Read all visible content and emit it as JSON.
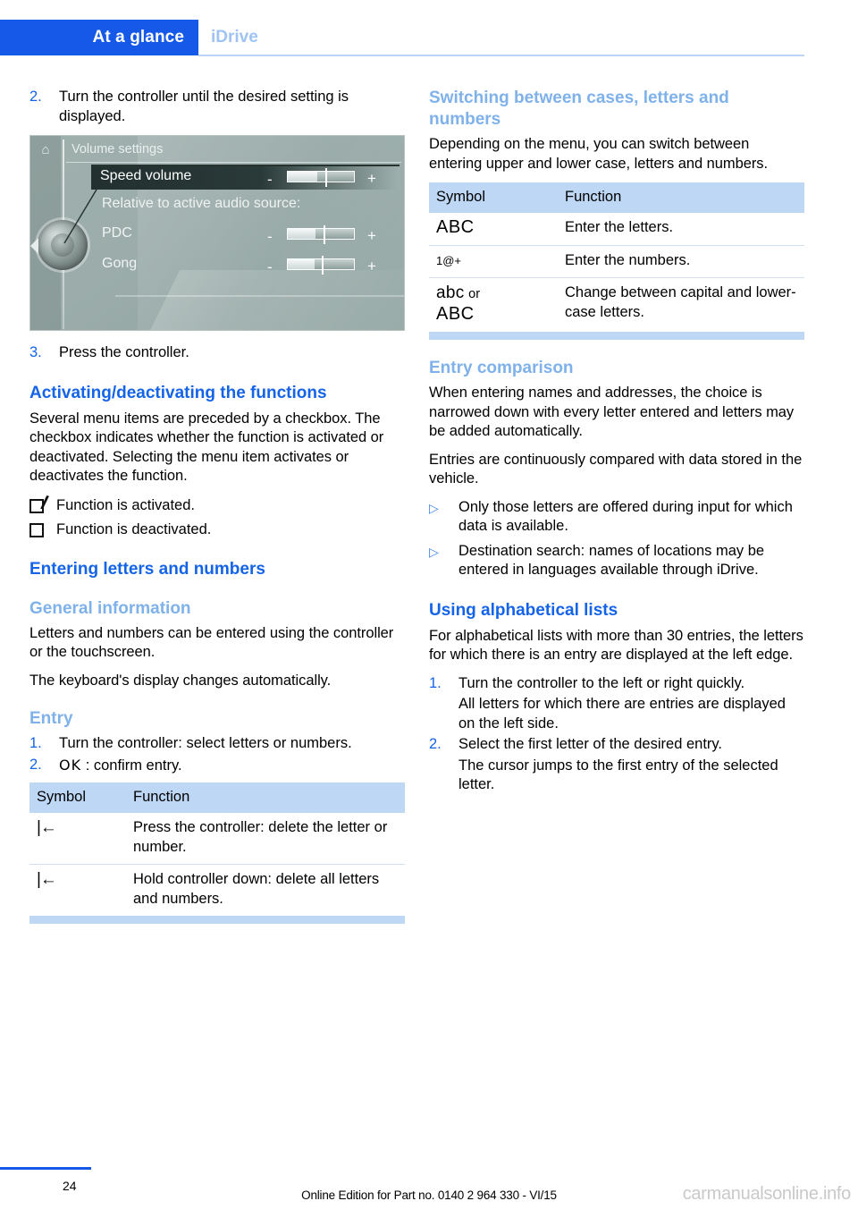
{
  "header": {
    "active_tab": "At a glance",
    "inactive_tab": "iDrive"
  },
  "colors": {
    "brand_blue": "#1659e8",
    "heading_blue": "#1564e8",
    "subheading_blue": "#7fb1ea",
    "table_header_blue": "#bdd7f4",
    "table_rule_blue": "#cfe0f5"
  },
  "left_column": {
    "step2": {
      "num": "2.",
      "text": "Turn the controller until the desired setting is displayed."
    },
    "idrive_screenshot": {
      "home_icon": "home-icon",
      "title": "Volume settings",
      "selected_row_label": "Speed volume",
      "subtitle": "Relative to active audio source:",
      "rows": [
        {
          "label": "PDC",
          "minus": "-",
          "plus": "+"
        },
        {
          "label": "Gong",
          "minus": "-",
          "plus": "+"
        }
      ],
      "selected_row_minus": "-",
      "selected_row_plus": "+"
    },
    "step3": {
      "num": "3.",
      "text": "Press the controller."
    },
    "heading_activating": "Activating/deactivating the functions",
    "para_checkbox": "Several menu items are preceded by a checkbox. The checkbox indicates whether the function is activated or deactivated. Selecting the menu item activates or deactivates the function.",
    "checkbox_lines": [
      {
        "state": "checked",
        "text": "Function is activated."
      },
      {
        "state": "unchecked",
        "text": "Function is deactivated."
      }
    ],
    "heading_entering": "Entering letters and numbers",
    "subheading_general": "General information",
    "para_general_1": "Letters and numbers can be entered using the controller or the touchscreen.",
    "para_general_2": "The keyboard's display changes automatically.",
    "subheading_entry": "Entry",
    "entry_steps": [
      {
        "num": "1.",
        "text": "Turn the controller: select letters or numbers."
      },
      {
        "num": "2.",
        "symbol": "OK",
        "text": ": confirm entry."
      }
    ],
    "table": {
      "headers": [
        "Symbol",
        "Function"
      ],
      "rows": [
        {
          "symbol": "|←",
          "symbol_name": "delete-left-icon",
          "function": "Press the controller: delete the letter or number."
        },
        {
          "symbol": "|←",
          "symbol_name": "delete-left-icon",
          "function": "Hold controller down: delete all letters and numbers."
        }
      ]
    }
  },
  "right_column": {
    "heading_switching": "Switching between cases, letters and numbers",
    "para_switching": "Depending on the menu, you can switch between entering upper and lower case, letters and numbers.",
    "table": {
      "headers": [
        "Symbol",
        "Function"
      ],
      "rows": [
        {
          "symbol": "ABC",
          "function": "Enter the letters."
        },
        {
          "symbol": "1@+",
          "function": "Enter the numbers."
        },
        {
          "symbol": "abc",
          "symbol_or": "or",
          "symbol_alt": "ABC",
          "function": "Change between capital and lower-case letters."
        }
      ]
    },
    "subheading_entry_comparison": "Entry comparison",
    "para_comparison_1": "When entering names and addresses, the choice is narrowed down with every letter entered and letters may be added automatically.",
    "para_comparison_2": "Entries are continuously compared with data stored in the vehicle.",
    "bullets": [
      "Only those letters are offered during input for which data is available.",
      "Destination search: names of locations may be entered in languages available through iDrive."
    ],
    "heading_alphabetical": "Using alphabetical lists",
    "para_alphabetical": "For alphabetical lists with more than 30 entries, the letters for which there is an entry are displayed at the left edge.",
    "alpha_steps": [
      {
        "num": "1.",
        "text": "Turn the controller to the left or right quickly.",
        "sub": "All letters for which there are entries are displayed on the left side."
      },
      {
        "num": "2.",
        "text": "Select the first letter of the desired entry.",
        "sub": "The cursor jumps to the first entry of the selected letter."
      }
    ]
  },
  "footer": {
    "page_number": "24",
    "edition_text": "Online Edition for Part no. 0140 2 964 330 - VI/15",
    "watermark": "carmanualsonline.info"
  }
}
